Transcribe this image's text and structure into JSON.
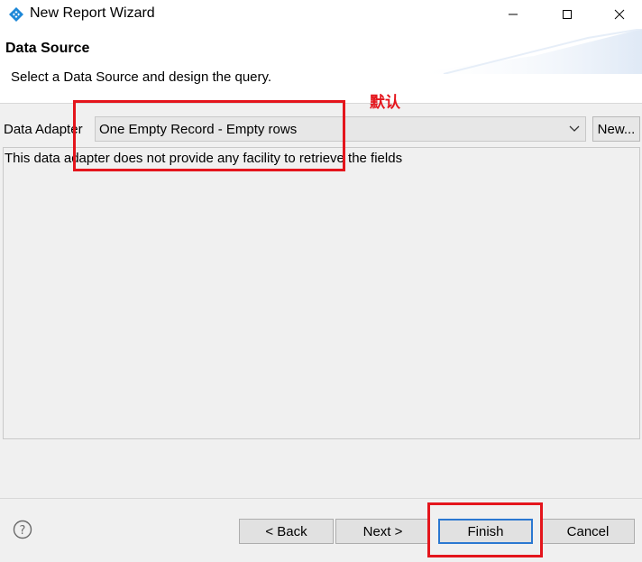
{
  "window": {
    "title": "New Report Wizard"
  },
  "header": {
    "heading": "Data Source",
    "description": "Select a Data Source and design the query."
  },
  "annotation": {
    "label": "默认",
    "color": "#e4151c"
  },
  "adapter": {
    "label": "Data Adapter",
    "selected": "One Empty Record - Empty rows",
    "new_label": "New..."
  },
  "info": {
    "text": "This data adapter does not provide any facility to retrieve the fields"
  },
  "footer": {
    "back_label": "< Back",
    "next_label": "Next >",
    "finish_label": "Finish",
    "cancel_label": "Cancel"
  },
  "colors": {
    "accent": "#2b78d1",
    "annotation": "#e4151c"
  },
  "icons": [
    "app-icon",
    "minimize-icon",
    "maximize-icon",
    "close-icon",
    "chevron-down-icon",
    "help-icon"
  ]
}
